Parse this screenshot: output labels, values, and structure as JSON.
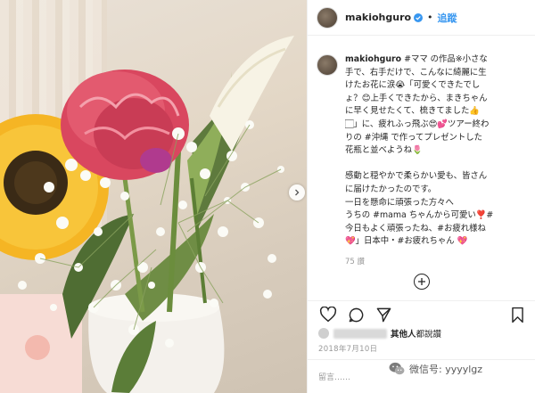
{
  "post": {
    "username": "makiohguro",
    "separator": "•",
    "follow_label": "追蹤"
  },
  "caption": {
    "username": "makiohguro",
    "lines": [
      "#ママ の作品※小さな",
      "手で、右手だけで、こんなに綺麗に生",
      "けたお花に涙😭「可愛くできたでし",
      "ょ？😊上手くできたから、まきちゃん",
      "に早く見せたくて、梳きてました👍",
      "🏻」に、疲れふっ飛ぶ😍💕ツアー終わ",
      "りの #沖縄 で作ってプレゼントした",
      "花瓶と並べようね🌷",
      "",
      "感動と穏やかで柔らかい愛も、皆さん",
      "に届けたかったのです。",
      "一日を懸命に頑張った方々へ",
      "うちの #mama ちゃんから可愛い❣️#",
      "今日もよく頑張ったね、#お疲れ様ね",
      "💖」日本中・#お疲れちゃん 💖"
    ],
    "likes_count": "75 讚"
  },
  "liked_by": {
    "text": "其他人",
    "suffix": "都說讚"
  },
  "date": "2018年7月10日",
  "comment": {
    "placeholder": "留言……"
  },
  "watermark": {
    "text": "微信号: yyyylgz"
  },
  "icons": {
    "heart": "heart-icon",
    "comment": "comment-icon",
    "share": "share-icon",
    "save": "bookmark-icon",
    "verified": "verified-badge-icon",
    "add_comment": "plus-circle-icon",
    "next": "chevron-right-icon",
    "wechat": "wechat-icon"
  },
  "colors": {
    "accent": "#3897f0",
    "verified": "#3897f0",
    "text": "#262626",
    "muted": "#999999"
  }
}
